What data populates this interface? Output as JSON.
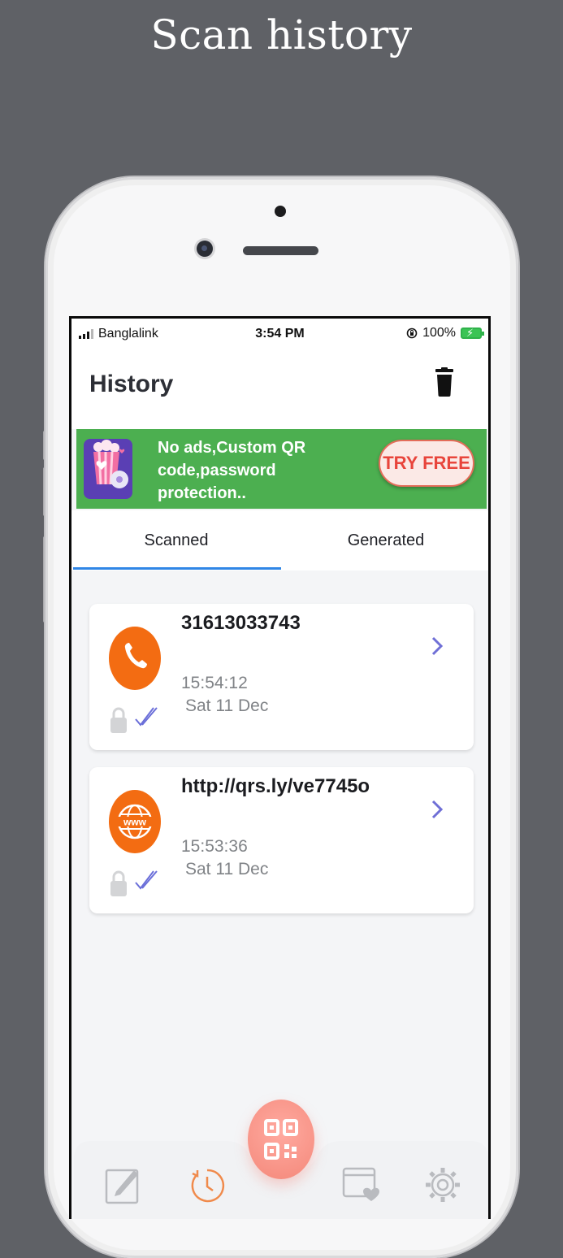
{
  "promo": {
    "title": "Scan history"
  },
  "status_bar": {
    "carrier": "Banglalink",
    "time": "3:54 PM",
    "battery": "100%"
  },
  "header": {
    "title": "History",
    "delete_icon": "trash-icon"
  },
  "banner": {
    "text": "No ads,Custom QR code,password protection..",
    "button_label": "TRY FREE",
    "icon": "popcorn-gift-icon",
    "background": "#4caf50",
    "button_text_color": "#e8453c"
  },
  "tabs": {
    "items": [
      "Scanned",
      "Generated"
    ],
    "active": "Scanned",
    "underline_color": "#2f86e6"
  },
  "history": [
    {
      "value": "31613033743",
      "time": "15:54:12",
      "date": "Sat 11 Dec",
      "type_icon": "phone-icon",
      "icon_color": "#f36c12"
    },
    {
      "value": "http://qrs.ly/ve7745o",
      "time": "15:53:36",
      "date": "Sat 11 Dec",
      "type_icon": "www-globe-icon",
      "icon_color": "#f36c12"
    }
  ],
  "bottom_nav": {
    "items": [
      "edit-icon",
      "history-clock-icon",
      "favorites-icon",
      "settings-gear-icon"
    ],
    "active": "history-clock-icon",
    "fab_icon": "qr-code-icon",
    "accent": "#f4887a"
  }
}
